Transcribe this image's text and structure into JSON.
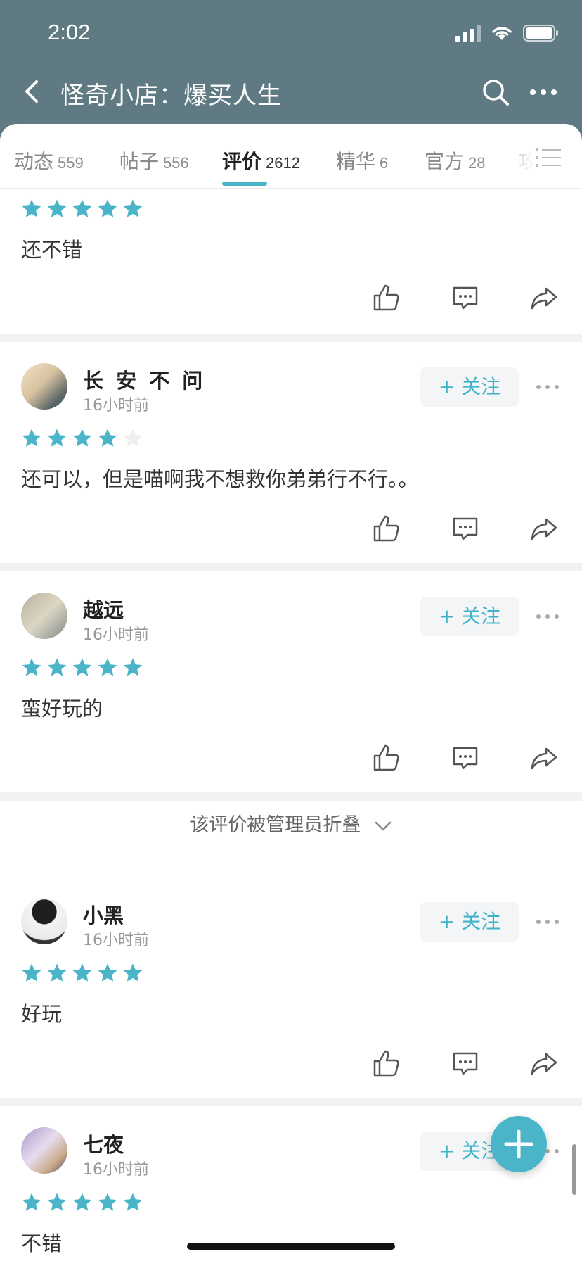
{
  "status_bar": {
    "time": "2:02"
  },
  "nav": {
    "title": "怪奇小店：爆买人生"
  },
  "tabs": [
    {
      "label": "动态",
      "count": "559"
    },
    {
      "label": "帖子",
      "count": "556"
    },
    {
      "label": "评价",
      "count": "2612"
    },
    {
      "label": "精华",
      "count": "6"
    },
    {
      "label": "官方",
      "count": "28"
    },
    {
      "label": "攻",
      "count": ""
    }
  ],
  "active_tab": "评价",
  "follow_label": "+ 关注",
  "reviews": [
    {
      "username": "",
      "time": "",
      "rating": 5,
      "text": "还不错"
    },
    {
      "username": "长 安 不 问",
      "time": "16小时前",
      "rating": 4,
      "text": "还可以，但是喵啊我不想救你弟弟行不行。。"
    },
    {
      "username": "越远",
      "time": "16小时前",
      "rating": 5,
      "text": "蛮好玩的"
    },
    {
      "username": "小黑",
      "time": "16小时前",
      "rating": 5,
      "text": "好玩"
    },
    {
      "username": "七夜",
      "time": "16小时前",
      "rating": 5,
      "text": "不错"
    }
  ],
  "folded_notice": "该评价被管理员折叠",
  "colors": {
    "header_bg": "#5f7a83",
    "accent": "#4ab5c8",
    "star_empty": "#eeeeee"
  },
  "icons": [
    "back-icon",
    "search-icon",
    "more-icon",
    "list-icon",
    "like-icon",
    "comment-icon",
    "share-icon",
    "chevron-down-icon",
    "plus-icon"
  ]
}
